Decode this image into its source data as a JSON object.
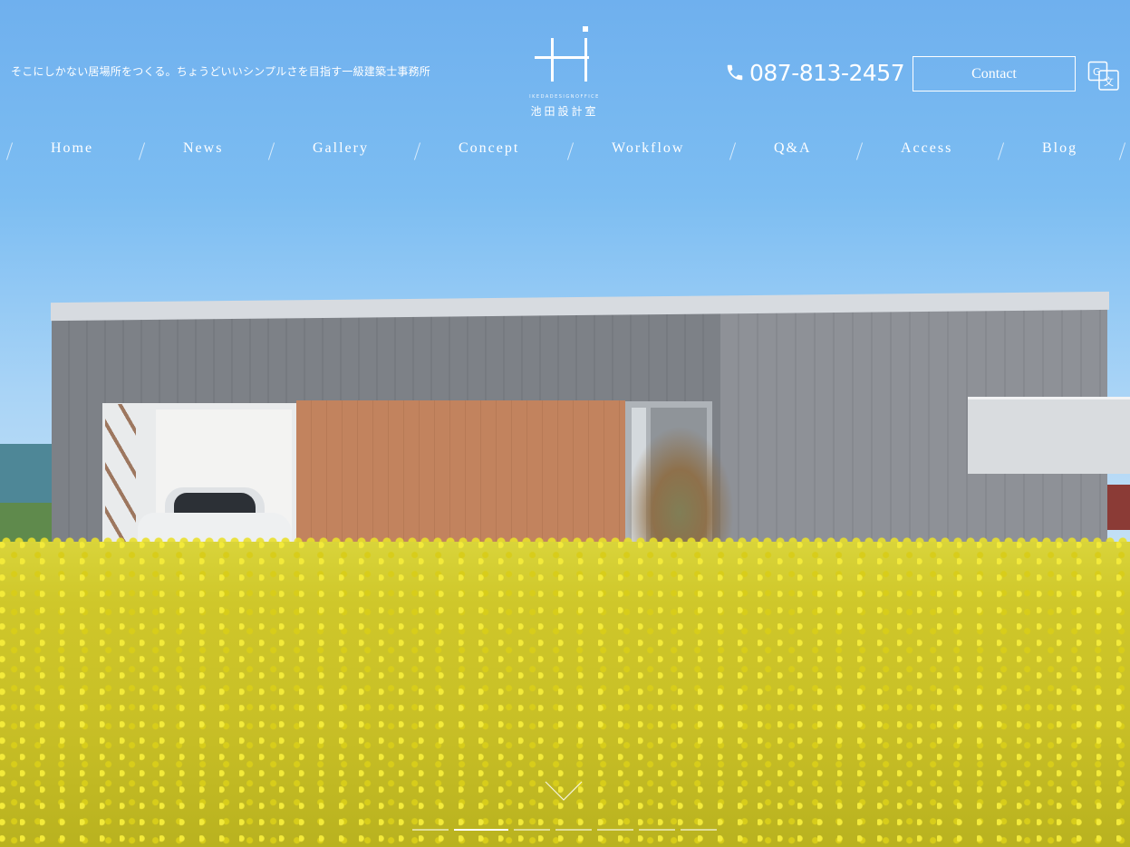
{
  "header": {
    "tagline": "そこにしかない居場所をつくる。ちょうどいいシンプルさを目指す一級建築士事務所",
    "logo_en": "IKEDADESIGNOFFICE",
    "logo_jp": "池田設計室",
    "phone": "087-813-2457",
    "contact_label": "Contact"
  },
  "nav": {
    "items": [
      {
        "label": "Home"
      },
      {
        "label": "News"
      },
      {
        "label": "Gallery"
      },
      {
        "label": "Concept"
      },
      {
        "label": "Workflow"
      },
      {
        "label": "Q&A"
      },
      {
        "label": "Access"
      },
      {
        "label": "Blog"
      }
    ]
  },
  "slider": {
    "total_slides": 7,
    "active_slide": 2
  }
}
